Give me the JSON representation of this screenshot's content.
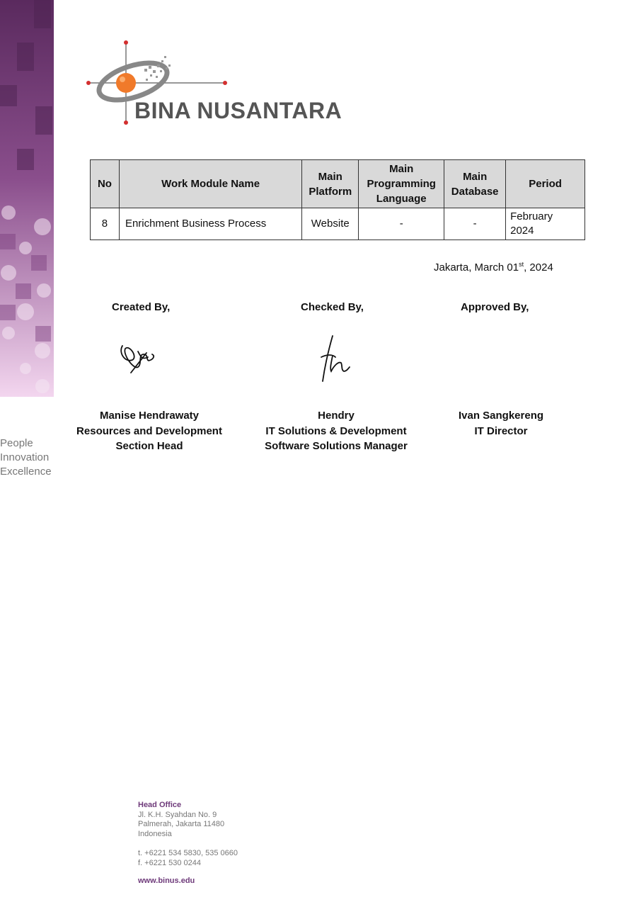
{
  "brand": {
    "name": "BINA NUSANTARA",
    "tagline": [
      "People",
      "Innovation",
      "Excellence"
    ]
  },
  "table": {
    "headers": [
      [
        "No"
      ],
      [
        "Work Module Name"
      ],
      [
        "Main",
        "Platform"
      ],
      [
        "Main",
        "Programming",
        "Language"
      ],
      [
        "Main",
        "Database"
      ],
      [
        "Period"
      ]
    ],
    "rows": [
      {
        "no": "8",
        "module": "Enrichment Business Process",
        "platform": "Website",
        "language": "-",
        "database": "-",
        "period": [
          "February",
          "2024"
        ]
      }
    ]
  },
  "date": {
    "prefix": "Jakarta, March 01",
    "sup": "st",
    "suffix": ", 2024"
  },
  "signatures": {
    "created": {
      "heading": "Created By,",
      "name": "Manise Hendrawaty",
      "title_lines": [
        "Resources and Development",
        "Section Head"
      ]
    },
    "checked": {
      "heading": "Checked By,",
      "name": "Hendry",
      "title_lines": [
        "IT Solutions & Development",
        "Software Solutions Manager"
      ]
    },
    "approved": {
      "heading": "Approved By,",
      "name": "Ivan Sangkereng",
      "title_lines": [
        "IT Director"
      ]
    }
  },
  "footer": {
    "head": "Head Office",
    "address": [
      "Jl. K.H. Syahdan No. 9",
      "Palmerah, Jakarta 11480",
      "Indonesia"
    ],
    "phone": "t. +6221 534 5830, 535 0660",
    "fax": "f. +6221 530 0244",
    "website": "www.binus.edu"
  },
  "colors": {
    "brand_purple": "#6e3a7a",
    "brand_orange": "#f07a2a",
    "logo_gray": "#555555",
    "accent_red": "#d32f2f"
  }
}
